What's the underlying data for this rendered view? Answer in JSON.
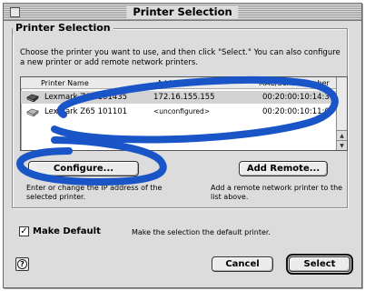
{
  "window": {
    "title": "Printer Selection"
  },
  "group": {
    "title": "Printer Selection",
    "instructions": "Choose the printer you want to use, and then click \"Select.\" You can also configure a new printer or add remote network printers."
  },
  "list": {
    "headers": [
      "Printer Name",
      "Address",
      "MAC/Serial Number"
    ],
    "rows": [
      {
        "name": "Lexmark Z65 101435",
        "address": "172.16.155.155",
        "mac": "00:20:00:10:14:3",
        "selected": true
      },
      {
        "name": "Lexmark Z65 101101",
        "address": "<unconfigured>",
        "mac": "00:20:00:10:11:0",
        "selected": false
      }
    ]
  },
  "buttons": {
    "configure": "Configure...",
    "add_remote": "Add Remote...",
    "cancel": "Cancel",
    "select": "Select",
    "help": "?"
  },
  "descriptions": {
    "configure": "Enter or change the IP address of the selected printer.",
    "add_remote": "Add a remote network printer to the list above."
  },
  "make_default": {
    "label": "Make Default",
    "checked": true,
    "check_glyph": "✓",
    "description": "Make the selection the default printer."
  },
  "scrollbar": {
    "up_glyph": "▲",
    "down_glyph": "▼"
  },
  "colors": {
    "annotation": "#1a55c8",
    "selected_row": "#d3d3d3"
  }
}
